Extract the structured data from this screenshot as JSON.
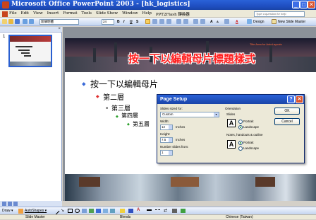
{
  "window": {
    "title": "Microsoft Office PowerPoint 2003 - [hk_logistics]",
    "min": "_",
    "max": "□",
    "close": "✕"
  },
  "menubar": {
    "items": [
      "File",
      "Edit",
      "View",
      "Insert",
      "Format",
      "Tools",
      "Slide Show",
      "Window",
      "Help",
      "PPT2Flash 轉換器"
    ],
    "help_placeholder": "Type a question for help"
  },
  "toolbar": {
    "font_name": "新細明體",
    "font_size": "24",
    "bold": "B",
    "italic": "I",
    "underline": "U",
    "shadow": "S",
    "increase_font": "A",
    "decrease_font": "A",
    "font_color": "A",
    "design_label": "Design",
    "new_slide_label": "New Slide Master"
  },
  "slides_panel": {
    "slide_number": "1",
    "close": "×"
  },
  "slide": {
    "title": "按一下以編輯母片標題樣式",
    "title_area_hint": "Title Area for AutoLayouts",
    "levels": [
      {
        "text": "按一下以編輯母片",
        "bullet": "⬥"
      },
      {
        "text": "第二層",
        "bullet": "◆"
      },
      {
        "text": "第三層",
        "bullet": "■"
      },
      {
        "text": "第四層",
        "bullet": "◆"
      },
      {
        "text": "第五層",
        "bullet": "◆"
      }
    ]
  },
  "dialog": {
    "title": "Page Setup",
    "help_btn": "?",
    "close_btn": "✕",
    "sized_for_label": "Slides sized for:",
    "sized_for_value": "Custom",
    "width_label": "Width:",
    "width_value": "12",
    "width_unit": "Inches",
    "height_label": "Height:",
    "height_value": "7.5",
    "height_unit": "Inches",
    "number_from_label": "Number slides from:",
    "number_from_value": "1",
    "orientation_label": "Orientation",
    "slides_label": "Slides",
    "portrait_label": "Portrait",
    "landscape_label": "Landscape",
    "notes_label": "Notes, handouts & outline",
    "notes_portrait_label": "Portrait",
    "notes_landscape_label": "Landscape",
    "slides_orientation": "landscape",
    "notes_orientation": "portrait",
    "ok_label": "OK",
    "cancel_label": "Cancel"
  },
  "drawbar": {
    "draw_label": "Draw ▾",
    "autoshapes_label": "AutoShapes ▾"
  },
  "statusbar": {
    "view": "Slide Master",
    "design": "Blends",
    "language": "Chinese (Taiwan)"
  },
  "colors": {
    "titlebar": "#1f4fc2",
    "slide_title": "#ff2020",
    "accent_orange": "#ff6a3a"
  }
}
